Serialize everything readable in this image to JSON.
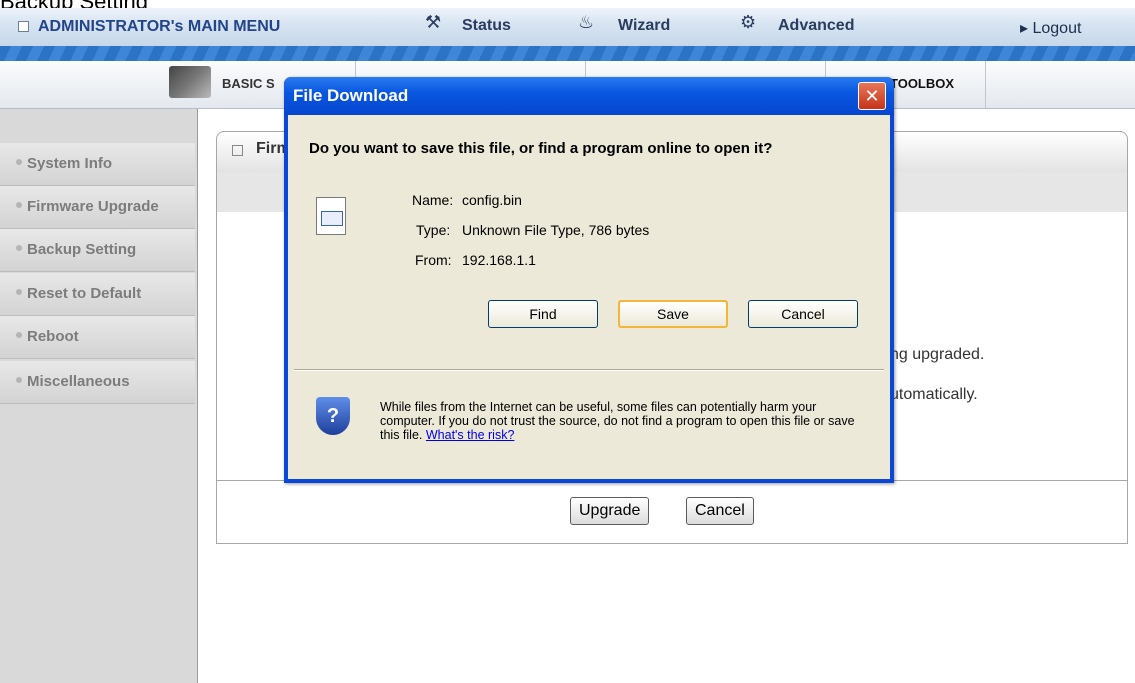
{
  "cropped_caption": "Backup Setting",
  "top_menu": {
    "admin_title": "ADMINISTRATOR's MAIN MENU",
    "items": [
      {
        "label": "Status",
        "icon": "status-icon"
      },
      {
        "label": "Wizard",
        "icon": "wizard-icon"
      },
      {
        "label": "Advanced",
        "icon": "advanced-icon"
      }
    ],
    "logout": "Logout"
  },
  "tabs": {
    "basic": "BASIC S",
    "toolbox": "TOOLBOX"
  },
  "sidebar": {
    "items": [
      {
        "label": "System Info"
      },
      {
        "label": "Firmware Upgrade"
      },
      {
        "label": "Backup Setting"
      },
      {
        "label": "Reset to Default"
      },
      {
        "label": "Reboot"
      },
      {
        "label": "Miscellaneous"
      }
    ]
  },
  "panel": {
    "title": "Firm",
    "body_line1": "ng upgraded.",
    "body_line2": "utomatically.",
    "upgrade_button": "Upgrade",
    "cancel_button": "Cancel"
  },
  "dialog": {
    "title": "File Download",
    "question": "Do you want to save this file, or find a program online to open it?",
    "name_label": "Name:",
    "name_value": "config.bin",
    "type_label": "Type:",
    "type_value": "Unknown File Type, 786 bytes",
    "from_label": "From:",
    "from_value": "192.168.1.1",
    "find_button": "Find",
    "save_button": "Save",
    "cancel_button": "Cancel",
    "warning_text": "While files from the Internet can be useful, some files can potentially harm your computer. If you do not trust the source, do not find a program to open this file or save this file.",
    "risk_link": "What's the risk?"
  },
  "colors": {
    "dialog_title_blue": "#0a58e0",
    "dialog_body": "#ece9d8",
    "nav_stripe": "#2d73c5"
  }
}
